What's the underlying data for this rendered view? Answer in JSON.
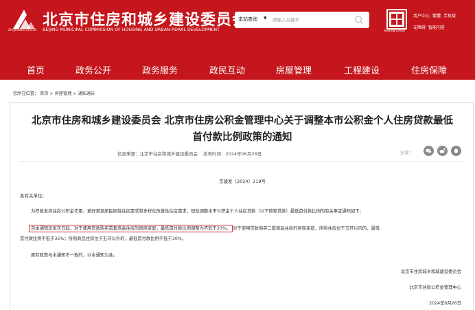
{
  "header": {
    "logo_caption": "ZHUJIANWEI.GOV.CN",
    "title": "北京市住房和城乡建设委员会",
    "subtitle": "BEIJING MUNICIPAL COMMISSION OF HOUSING AND URBAN-RURAL DEVELOPMENT",
    "search": {
      "scope": "本站查询",
      "placeholder": "请输入关键字"
    },
    "seal_caption": "Beijing-China",
    "top_links_row1": [
      "用户中心",
      "繁體",
      "手机版"
    ],
    "top_links_row2": [
      "无障碍",
      "智能问答"
    ]
  },
  "nav": {
    "items": [
      "首页",
      "政务公开",
      "政务服务",
      "政民互动",
      "房屋管理",
      "工程建设",
      "住房保障"
    ]
  },
  "breadcrumb": {
    "prefix": "您所在位置：",
    "items": [
      "首页",
      "房屋管理",
      "通知通告"
    ],
    "separator": ">"
  },
  "article": {
    "title_line1": "北京市住房和城乡建设委员会 北京市住房公积金管理中心关于调整本市公积金个人住房贷款最低",
    "title_line2": "首付款比例政策的通知",
    "source_label": "信息来源：北京市住房和城乡建设委员会",
    "date_label": "发布时间：2024年06月26日",
    "share_label": "分享：",
    "doc_number": "京建发〔2024〕219号",
    "greeting": "各有关单位：",
    "para1": "为积极发挥住房公积金作用，更好满足居民刚性住房需求和多样化改善性住房需求，现就调整本市公积金个人住房贷款（以下简称贷款）最低首付款比例的有关事宜通知如下：",
    "para2_highlight": "自本通知印发次日起，对于使用贷款购买首套商品住房的居民家庭，最低首付款比例调整为不低于20%。",
    "para2_rest": "对于使用贷款购买二套商品住房的居民家庭，所购住房位于五环以内的，最低",
    "para2_line2": "首付款比例不低于35%；所购商品住房位于五环以外的，最低首付款比例不低于30%。",
    "para3": "原有政策与本通知不一致的，以本通知为准。",
    "signatory1": "北京市住房城乡和城建设委员会",
    "signatory2": "北京市住房公积金管理中心",
    "sign_date": "2024年6月26日"
  },
  "colors": {
    "brand_red": "#c4161c",
    "highlight_red": "#d9232d"
  }
}
